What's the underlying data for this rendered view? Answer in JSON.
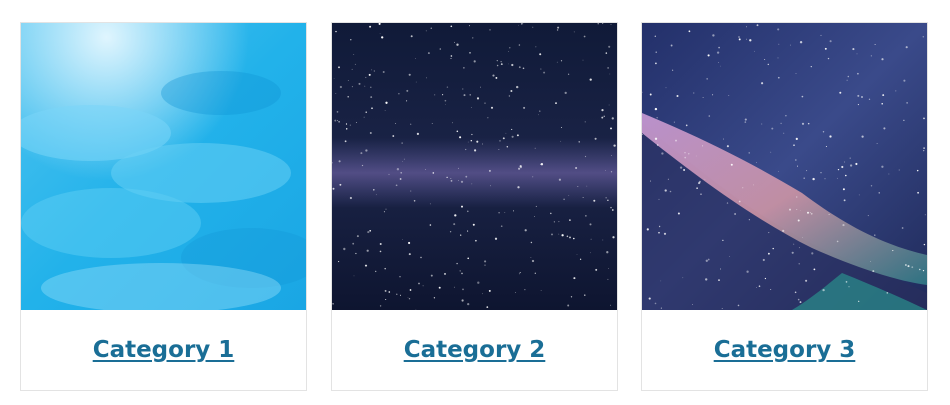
{
  "categories": [
    {
      "label": "Category 1",
      "image": "ocean-water-image"
    },
    {
      "label": "Category 2",
      "image": "starry-night-sky-image"
    },
    {
      "label": "Category 3",
      "image": "milky-way-nebula-image"
    }
  ],
  "colors": {
    "link": "#1a6e96",
    "card_border": "#e3e3e3"
  }
}
